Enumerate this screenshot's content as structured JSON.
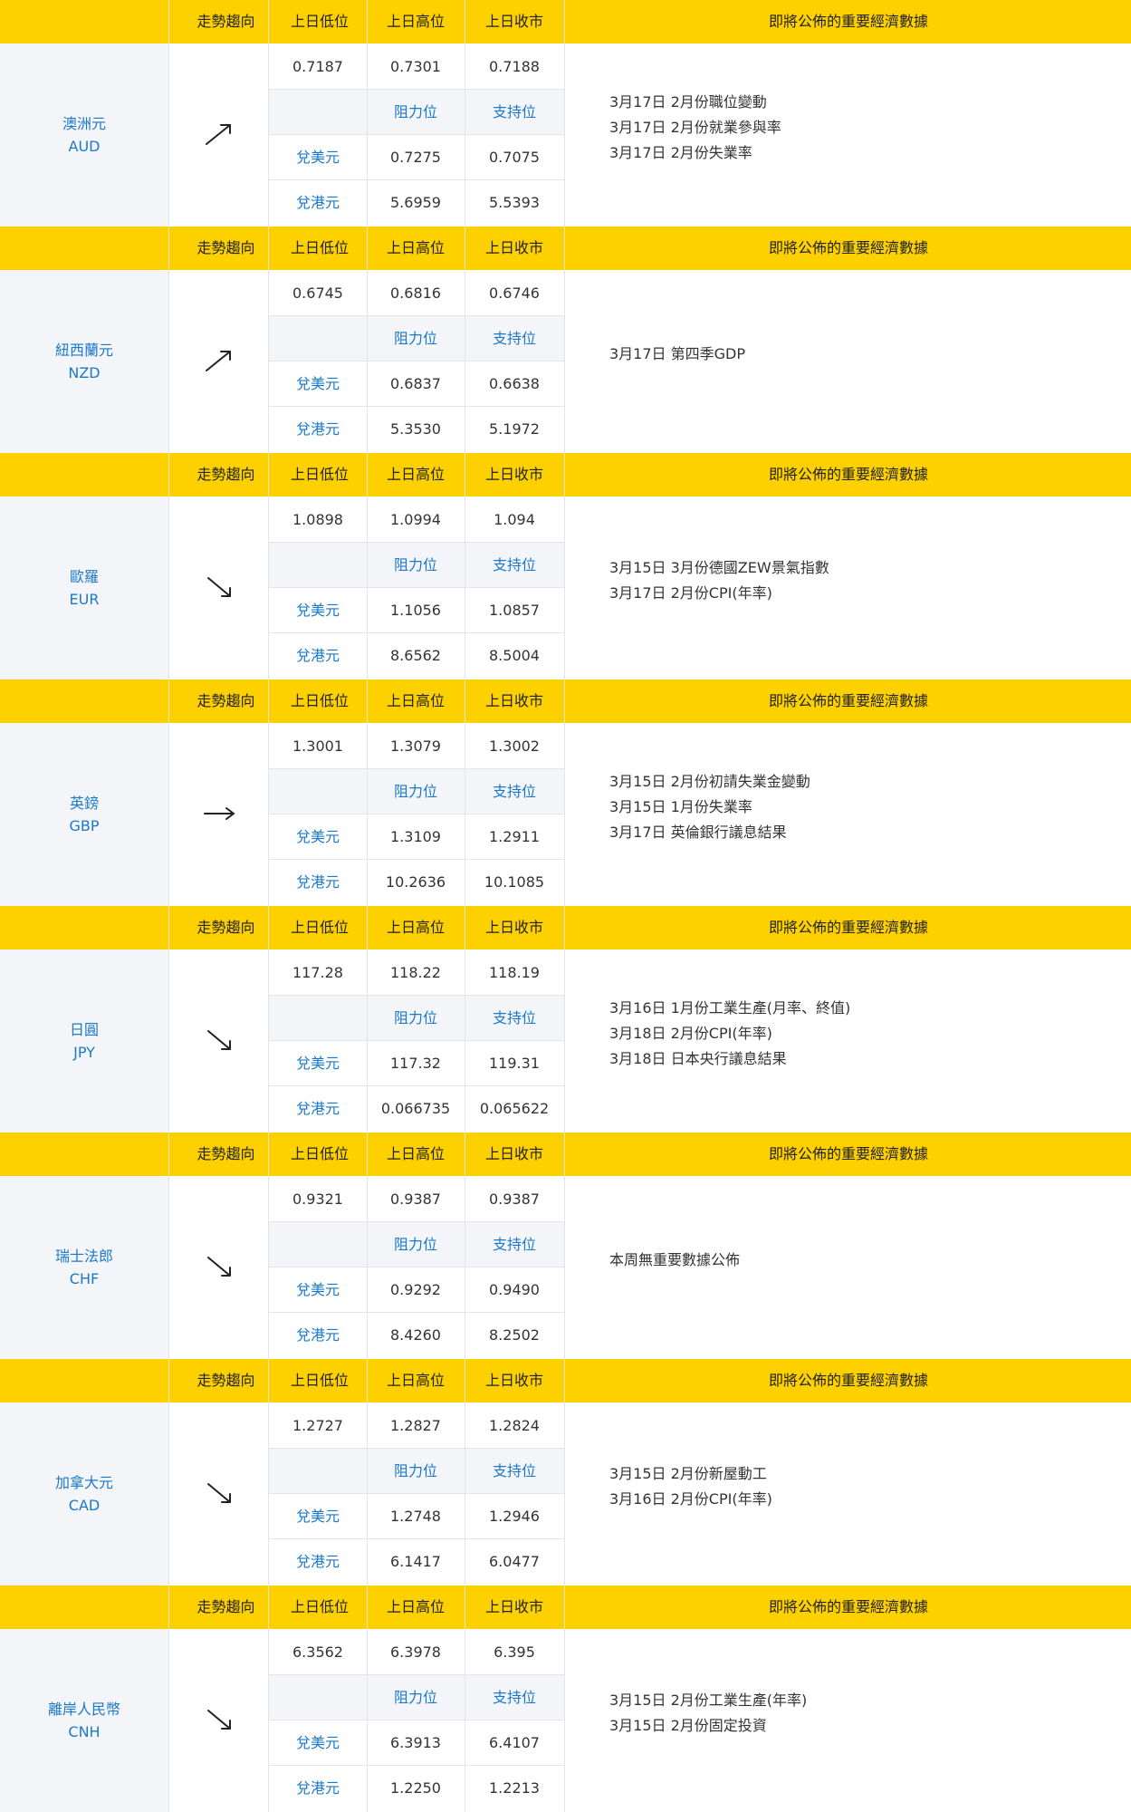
{
  "headers": {
    "trend": "走勢趨向",
    "prev_low": "上日低位",
    "prev_high": "上日高位",
    "prev_close": "上日收市",
    "economic_data": "即將公佈的重要經濟數據",
    "resistance": "阻力位",
    "support": "支持位",
    "vs_usd": "兌美元",
    "vs_hkd": "兌港元"
  },
  "currencies": [
    {
      "name_cn": "澳洲元",
      "code": "AUD",
      "trend": "up",
      "prev_low": "0.7187",
      "prev_high": "0.7301",
      "prev_close": "0.7188",
      "usd_res": "0.7275",
      "usd_sup": "0.7075",
      "hkd_res": "5.6959",
      "hkd_sup": "5.5393",
      "events": [
        "3月17日 2月份職位變動",
        "3月17日 2月份就業參與率",
        "3月17日 2月份失業率"
      ]
    },
    {
      "name_cn": "紐西蘭元",
      "code": "NZD",
      "trend": "up",
      "prev_low": "0.6745",
      "prev_high": "0.6816",
      "prev_close": "0.6746",
      "usd_res": "0.6837",
      "usd_sup": "0.6638",
      "hkd_res": "5.3530",
      "hkd_sup": "5.1972",
      "events": [
        "3月17日 第四季GDP"
      ]
    },
    {
      "name_cn": "歐羅",
      "code": "EUR",
      "trend": "down",
      "prev_low": "1.0898",
      "prev_high": "1.0994",
      "prev_close": "1.094",
      "usd_res": "1.1056",
      "usd_sup": "1.0857",
      "hkd_res": "8.6562",
      "hkd_sup": "8.5004",
      "events": [
        "3月15日 3月份德國ZEW景氣指數",
        "3月17日 2月份CPI(年率)"
      ]
    },
    {
      "name_cn": "英鎊",
      "code": "GBP",
      "trend": "flat",
      "prev_low": "1.3001",
      "prev_high": "1.3079",
      "prev_close": "1.3002",
      "usd_res": "1.3109",
      "usd_sup": "1.2911",
      "hkd_res": "10.2636",
      "hkd_sup": "10.1085",
      "events": [
        "3月15日 2月份初請失業金變動",
        "3月15日 1月份失業率",
        "3月17日 英倫銀行議息結果"
      ]
    },
    {
      "name_cn": "日圓",
      "code": "JPY",
      "trend": "down",
      "prev_low": "117.28",
      "prev_high": "118.22",
      "prev_close": "118.19",
      "usd_res": "117.32",
      "usd_sup": "119.31",
      "hkd_res": "0.066735",
      "hkd_sup": "0.065622",
      "events": [
        "3月16日 1月份工業生產(月率、終值)",
        "3月18日 2月份CPI(年率)",
        "3月18日 日本央行議息結果"
      ]
    },
    {
      "name_cn": "瑞士法郎",
      "code": "CHF",
      "trend": "down",
      "prev_low": "0.9321",
      "prev_high": "0.9387",
      "prev_close": "0.9387",
      "usd_res": "0.9292",
      "usd_sup": "0.9490",
      "hkd_res": "8.4260",
      "hkd_sup": "8.2502",
      "events": [
        "本周無重要數據公佈"
      ]
    },
    {
      "name_cn": "加拿大元",
      "code": "CAD",
      "trend": "down",
      "prev_low": "1.2727",
      "prev_high": "1.2827",
      "prev_close": "1.2824",
      "usd_res": "1.2748",
      "usd_sup": "1.2946",
      "hkd_res": "6.1417",
      "hkd_sup": "6.0477",
      "events": [
        "3月15日 2月份新屋動工",
        "3月16日 2月份CPI(年率)"
      ]
    },
    {
      "name_cn": "離岸人民幣",
      "code": "CNH",
      "trend": "down",
      "prev_low": "6.3562",
      "prev_high": "6.3978",
      "prev_close": "6.395",
      "usd_res": "6.3913",
      "usd_sup": "6.4107",
      "hkd_res": "1.2250",
      "hkd_sup": "1.2213",
      "events": [
        "3月15日 2月份工業生產(年率)",
        "3月15日 2月份固定投資"
      ]
    }
  ]
}
